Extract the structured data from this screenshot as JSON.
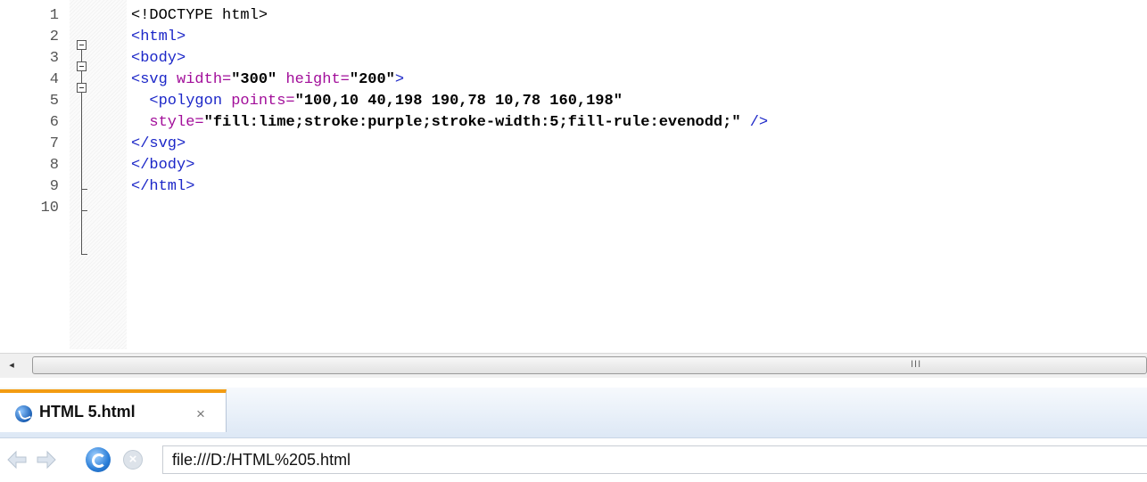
{
  "editor": {
    "line_numbers": [
      "1",
      "2",
      "3",
      "4",
      "5",
      "6",
      "7",
      "8",
      "9",
      "10"
    ],
    "lines": [
      [
        {
          "t": "<!DOCTYPE html>",
          "c": "plain"
        }
      ],
      [
        {
          "t": "<html>",
          "c": "tag"
        }
      ],
      [
        {
          "t": "<body>",
          "c": "tag"
        }
      ],
      [
        {
          "t": "<svg ",
          "c": "tag"
        },
        {
          "t": "width=",
          "c": "attr"
        },
        {
          "t": "\"300\"",
          "c": "val"
        },
        {
          "t": " height=",
          "c": "attr"
        },
        {
          "t": "\"200\"",
          "c": "val"
        },
        {
          "t": ">",
          "c": "tag"
        }
      ],
      [
        {
          "t": "  <polygon ",
          "c": "tag"
        },
        {
          "t": "points=",
          "c": "attr"
        },
        {
          "t": "\"100,10 40,198 190,78 10,78 160,198\"",
          "c": "val"
        }
      ],
      [
        {
          "t": "  style=",
          "c": "attr"
        },
        {
          "t": "\"fill:lime;stroke:purple;stroke-width:5;fill-rule:evenodd;\"",
          "c": "val"
        },
        {
          "t": " />",
          "c": "tag"
        }
      ],
      [
        {
          "t": "</svg>",
          "c": "tag"
        }
      ],
      [
        {
          "t": "</body>",
          "c": "tag"
        }
      ],
      [
        {
          "t": "</html>",
          "c": "tag"
        }
      ],
      []
    ]
  },
  "scrollbar": {
    "left_arrow": "◂",
    "grip": "III"
  },
  "browser": {
    "tab": {
      "title": "HTML 5.html",
      "close": "×",
      "icon": "browser-globe-icon"
    },
    "nav": {
      "back_icon": "back-arrow-icon",
      "forward_icon": "forward-arrow-icon",
      "reload_icon": "reload-icon",
      "stop_icon": "stop-icon",
      "stop_glyph": "×",
      "url": "file:///D:/HTML%205.html"
    },
    "accent_color": "#f39c12"
  }
}
